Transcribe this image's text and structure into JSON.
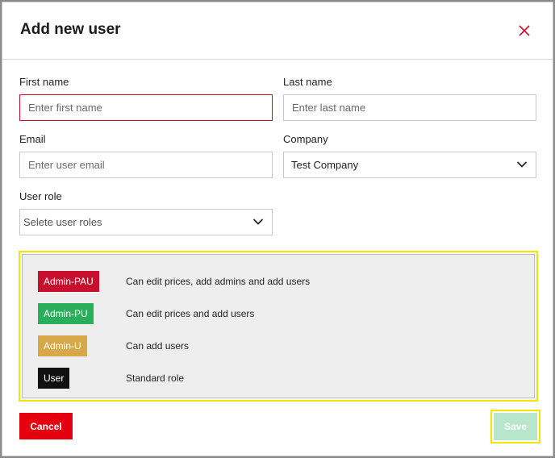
{
  "modal": {
    "title": "Add new user"
  },
  "form": {
    "first_name": {
      "label": "First name",
      "placeholder": "Enter first name",
      "value": ""
    },
    "last_name": {
      "label": "Last name",
      "placeholder": "Enter last name",
      "value": ""
    },
    "email": {
      "label": "Email",
      "placeholder": "Enter user email",
      "value": ""
    },
    "company": {
      "label": "Company",
      "selected": "Test Company"
    },
    "user_role": {
      "label": "User role",
      "placeholder": "Selete user roles"
    }
  },
  "roles": [
    {
      "badge": "Admin-PAU",
      "color": "#c8102e",
      "description": "Can edit prices, add admins and add users"
    },
    {
      "badge": "Admin-PU",
      "color": "#2aae5c",
      "description": "Can edit prices and add users"
    },
    {
      "badge": "Admin-U",
      "color": "#d6a84a",
      "description": "Can add users"
    },
    {
      "badge": "User",
      "color": "#111111",
      "description": "Standard role"
    }
  ],
  "actions": {
    "cancel_label": "Cancel",
    "save_label": "Save"
  },
  "colors": {
    "accent_red": "#e4000f",
    "focus_border": "#c8102e",
    "highlight": "#f2e600",
    "save_disabled": "#b7e6cc"
  }
}
